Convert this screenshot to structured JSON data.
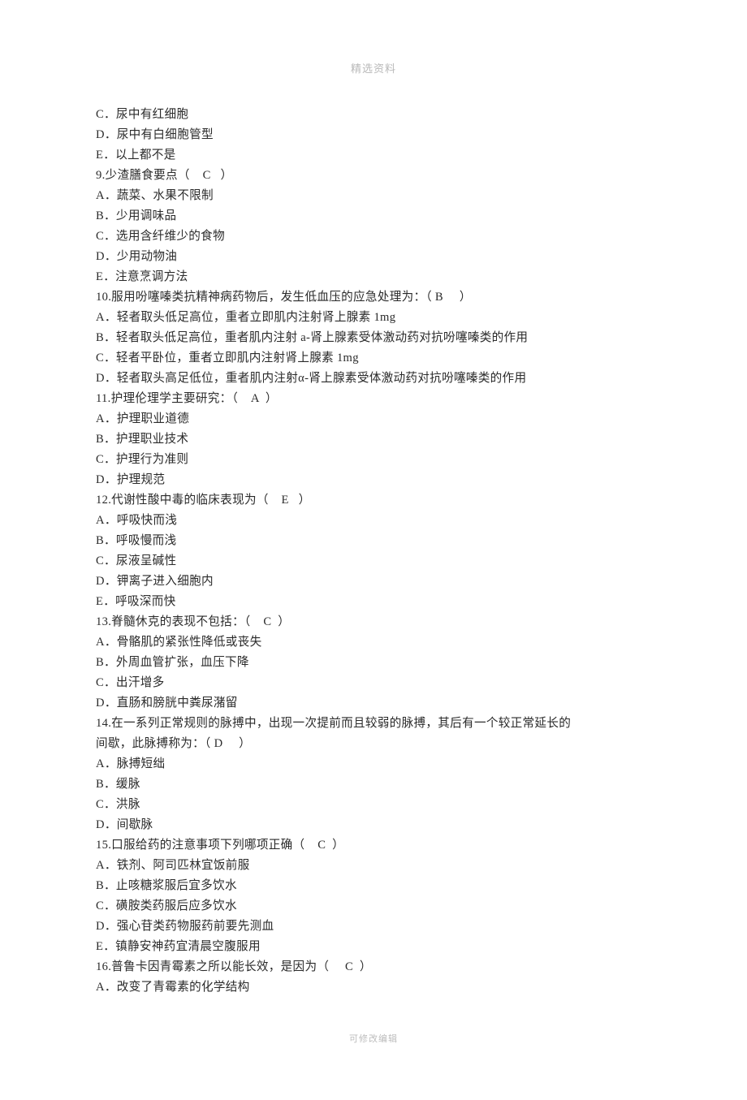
{
  "header": "精选资料",
  "footer": "可修改编辑",
  "lines": [
    "C．尿中有红细胞",
    "D．尿中有白细胞管型",
    "E．以上都不是",
    "9.少渣膳食要点（    C   ）",
    "A．蔬菜、水果不限制",
    "B．少用调味品",
    "C．选用含纤维少的食物",
    "D．少用动物油",
    "E．注意烹调方法",
    "10.服用吩噻嗪类抗精神病药物后，发生低血压的应急处理为：（ B     ）",
    "A．轻者取头低足高位，重者立即肌内注射肾上腺素 1mg",
    "B．轻者取头低足高位，重者肌内注射 a-肾上腺素受体激动药对抗吩噻嗪类的作用",
    "C．轻者平卧位，重者立即肌内注射肾上腺素 1mg",
    "D．轻者取头高足低位，重者肌内注射α-肾上腺素受体激动药对抗吩噻嗪类的作用",
    "11.护理伦理学主要研究：（    A  ）",
    "A．护理职业道德",
    "B．护理职业技术",
    "C．护理行为准则",
    "D．护理规范",
    "12.代谢性酸中毒的临床表现为（    E   ）",
    "A．呼吸快而浅",
    "B．呼吸慢而浅",
    "C．尿液呈碱性",
    "D．钾离子进入细胞内",
    "E．呼吸深而快",
    "13.脊髓休克的表现不包括：（    C  ）",
    "A．骨骼肌的紧张性降低或丧失",
    "B．外周血管扩张，血压下降",
    "C．出汗增多",
    "D．直肠和膀胱中粪尿潴留",
    "14.在一系列正常规则的脉搏中，出现一次提前而且较弱的脉搏，其后有一个较正常延长的",
    "间歇，此脉搏称为：（ D     ）",
    "A．脉搏短绌",
    "B．缓脉",
    "C．洪脉",
    "D．间歇脉",
    "15.口服给药的注意事项下列哪项正确（    C  ）",
    "A．铁剂、阿司匹林宜饭前服",
    "B．止咳糖浆服后宜多饮水",
    "C．磺胺类药服后应多饮水",
    "D．强心苷类药物服药前要先测血",
    "E．镇静安神药宜清晨空腹服用",
    "16.普鲁卡因青霉素之所以能长效，是因为（     C  ）",
    "A．改变了青霉素的化学结构"
  ]
}
